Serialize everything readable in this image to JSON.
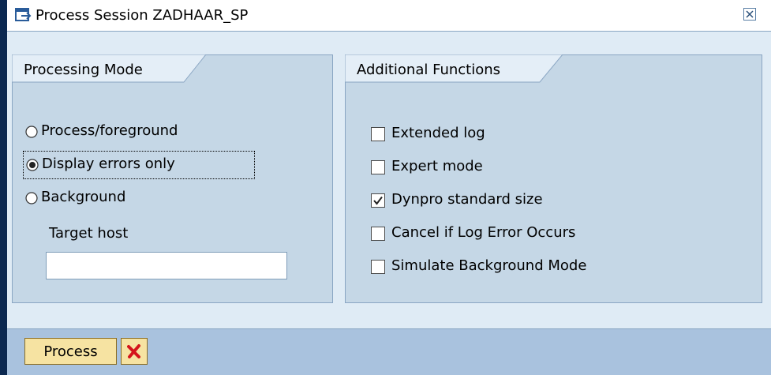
{
  "window": {
    "title": "Process Session ZADHAAR_SP",
    "title_icon": "session-window-icon",
    "close_icon": "close-icon"
  },
  "processing_mode": {
    "title": "Processing Mode",
    "options": [
      {
        "label": "Process/foreground",
        "selected": false
      },
      {
        "label": "Display errors only",
        "selected": true,
        "focused": true
      },
      {
        "label": "Background",
        "selected": false
      }
    ],
    "target_host": {
      "label": "Target host",
      "value": ""
    }
  },
  "additional_functions": {
    "title": "Additional Functions",
    "options": [
      {
        "label": "Extended log",
        "checked": false
      },
      {
        "label": "Expert mode",
        "checked": false
      },
      {
        "label": "Dynpro standard size",
        "checked": true
      },
      {
        "label": "Cancel if Log Error Occurs",
        "checked": false
      },
      {
        "label": "Simulate Background Mode",
        "checked": false
      }
    ]
  },
  "toolbar": {
    "process_label": "Process",
    "cancel_icon": "red-x-cancel-icon"
  },
  "colors": {
    "frame_dark": "#0b2850",
    "panel_bg": "#c5d7e6",
    "footer_bg": "#a9c2de",
    "button_bg": "#f6e3a2",
    "cancel_red": "#d4141c"
  }
}
